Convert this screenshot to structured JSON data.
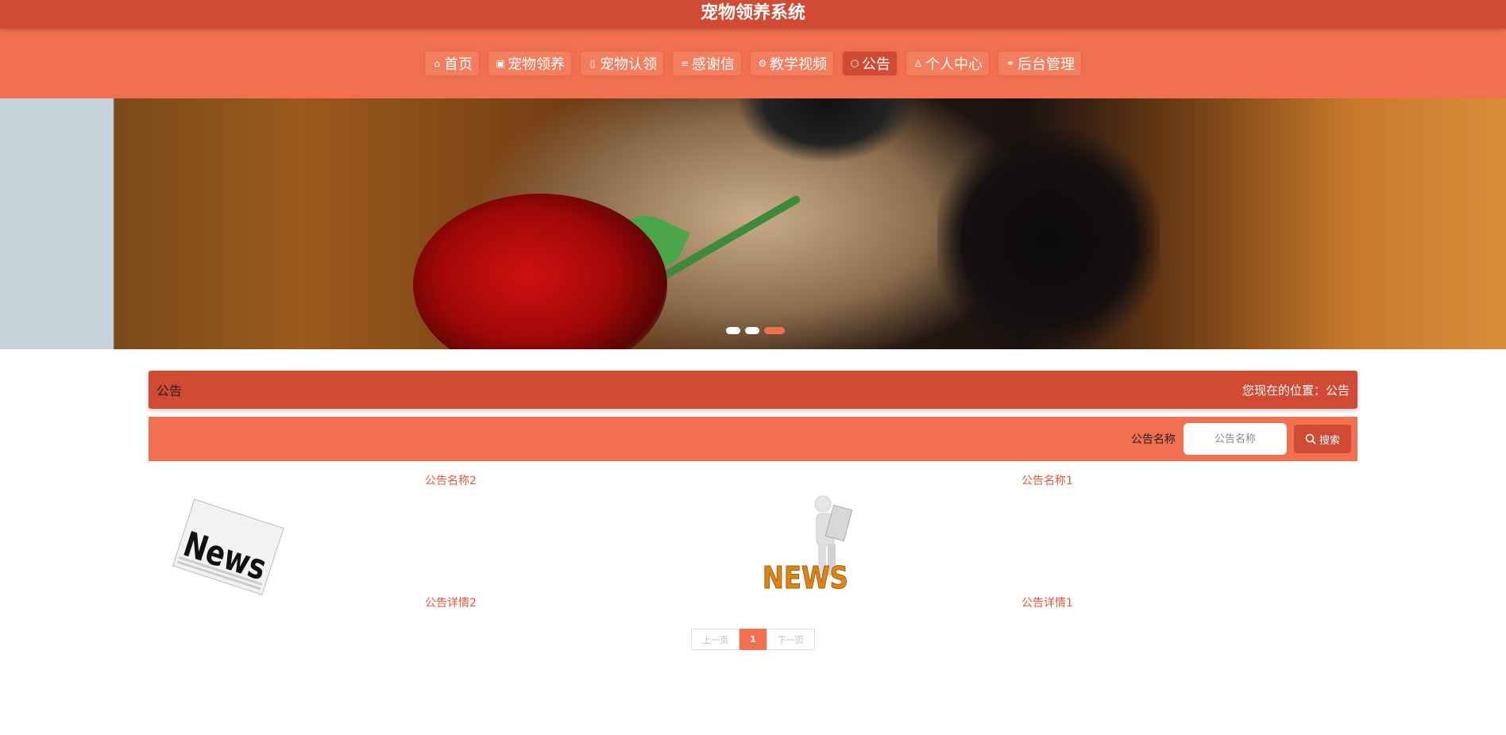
{
  "header": {
    "title": "宠物领养系统"
  },
  "nav": {
    "items": [
      {
        "label": "首页",
        "icon": "home-icon",
        "glyph": "⌂",
        "active": false
      },
      {
        "label": "宠物领养",
        "icon": "gift-icon",
        "glyph": "▣",
        "active": false
      },
      {
        "label": "宠物认领",
        "icon": "document-icon",
        "glyph": "▯",
        "active": false
      },
      {
        "label": "感谢信",
        "icon": "list-icon",
        "glyph": "≡",
        "active": false
      },
      {
        "label": "教学视频",
        "icon": "gear-icon",
        "glyph": "⚙",
        "active": false
      },
      {
        "label": "公告",
        "icon": "cube-icon",
        "glyph": "⬡",
        "active": true
      },
      {
        "label": "个人中心",
        "icon": "user-icon",
        "glyph": "♙",
        "active": false
      },
      {
        "label": "后台管理",
        "icon": "link-icon",
        "glyph": "⚭",
        "active": false
      }
    ]
  },
  "carousel": {
    "slide_count": 3,
    "active_index": 2
  },
  "page": {
    "title": "公告",
    "location_label": "您现在的位置：公告"
  },
  "search": {
    "label": "公告名称",
    "placeholder": "公告名称",
    "button_label": "搜索"
  },
  "announcements": [
    {
      "title": "公告名称2",
      "detail": "公告详情2",
      "image": "newspaper-image"
    },
    {
      "title": "公告名称1",
      "detail": "公告详情1",
      "image": "news-reader-image"
    }
  ],
  "pagination": {
    "prev": "上一页",
    "current": "1",
    "next": "下一页"
  },
  "colors": {
    "primary_dark": "#d14a33",
    "primary": "#f07050",
    "link": "#e8553d"
  }
}
